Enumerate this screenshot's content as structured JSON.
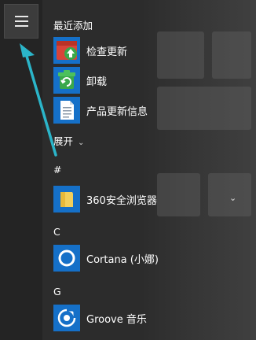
{
  "recently_added": {
    "header": "最近添加",
    "items": [
      {
        "label": "检查更新",
        "icon": "update-check-icon"
      },
      {
        "label": "卸载",
        "icon": "uninstall-icon"
      },
      {
        "label": "产品更新信息",
        "icon": "document-icon"
      }
    ]
  },
  "expand": {
    "label": "展开",
    "chevron": "⌄"
  },
  "groups": [
    {
      "letter": "#",
      "apps": [
        {
          "label": "360安全浏览器",
          "icon": "folder-icon",
          "expandable": true
        }
      ]
    },
    {
      "letter": "C",
      "apps": [
        {
          "label": "Cortana (小娜)",
          "icon": "cortana-icon"
        }
      ]
    },
    {
      "letter": "G",
      "apps": [
        {
          "label": "Groove 音乐",
          "icon": "groove-music-icon"
        }
      ]
    }
  ],
  "colors": {
    "accent": "#1570c8",
    "arrow": "#2bb5c9",
    "green": "#3aa84a",
    "red": "#d8443a"
  }
}
